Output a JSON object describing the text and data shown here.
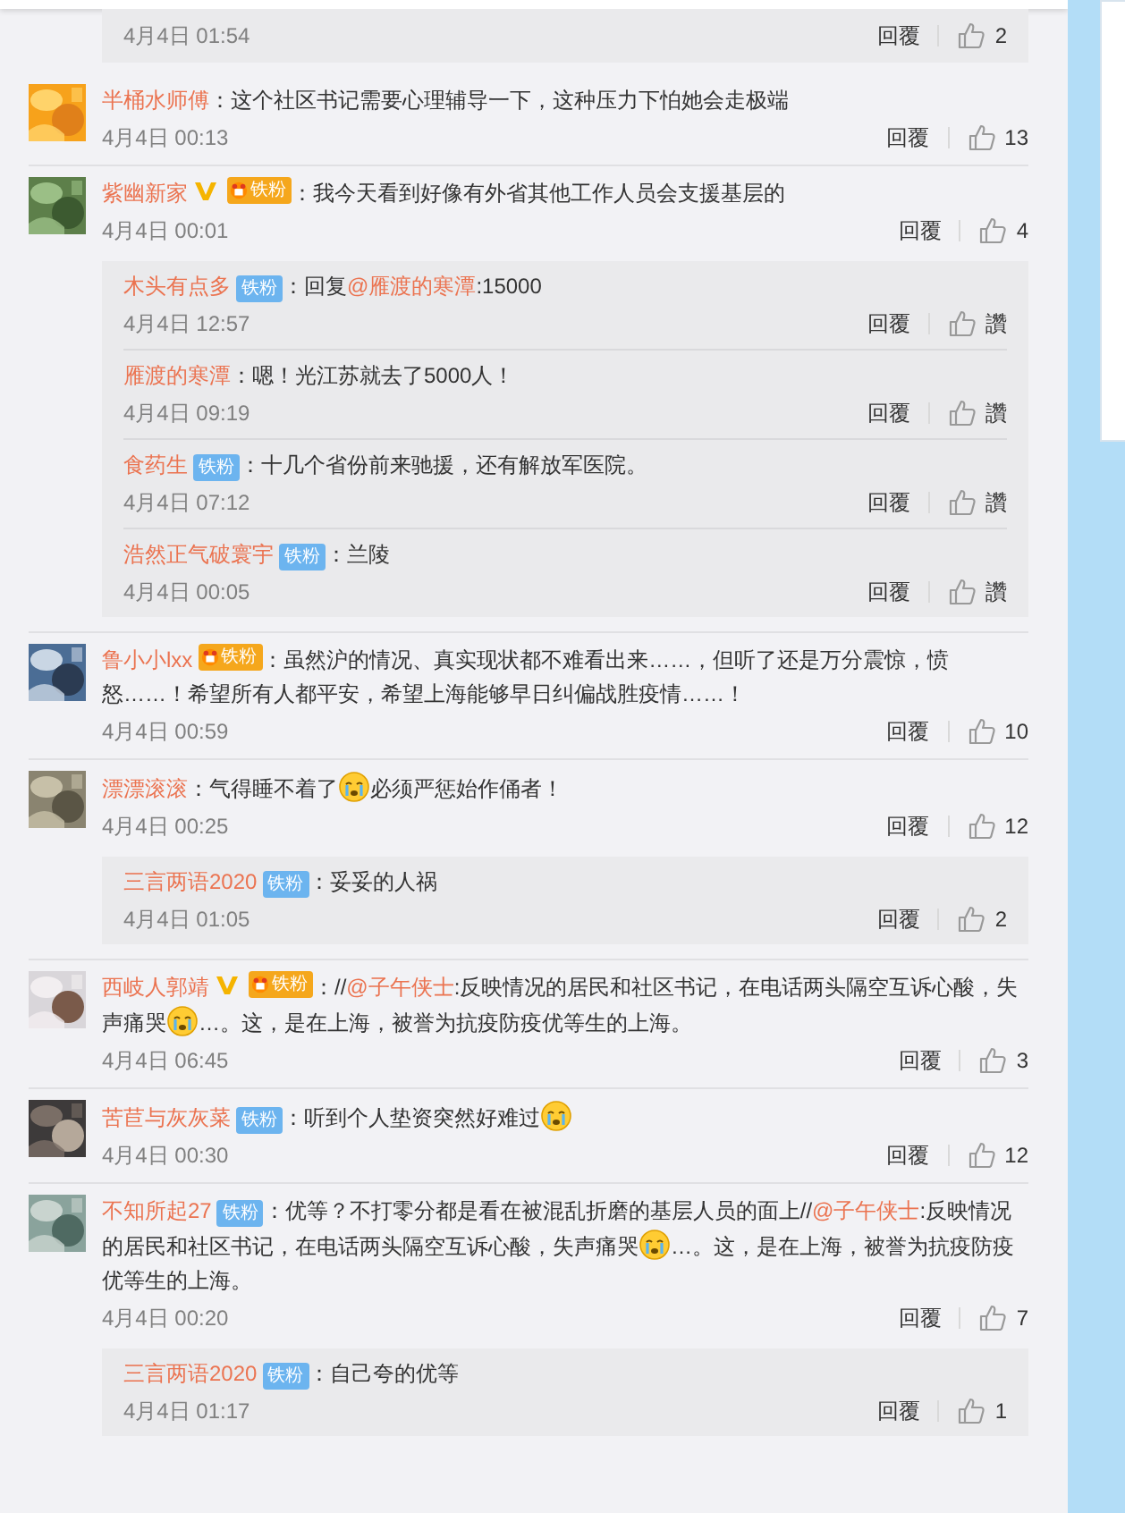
{
  "top_reply": {
    "time": "4月4日 01:54",
    "reply": "回覆",
    "likes": "2"
  },
  "comments": [
    {
      "user": "半桶水师傅",
      "verified": false,
      "segments": [
        {
          "kind": "text",
          "text": "：这个社区书记需要心理辅导一下，这种压力下怕她会走极端"
        }
      ],
      "time": "4月4日 00:13",
      "reply": "回覆",
      "likes": "13"
    },
    {
      "user": "紫幽新家",
      "verified": true,
      "badge": {
        "kind": "gold",
        "label": "铁粉"
      },
      "segments": [
        {
          "kind": "text",
          "text": "：我今天看到好像有外省其他工作人员会支援基层的"
        }
      ],
      "time": "4月4日 00:01",
      "reply": "回覆",
      "likes": "4",
      "replies": [
        {
          "user": "木头有点多",
          "badge": {
            "kind": "blue",
            "label": "铁粉"
          },
          "segments": [
            {
              "kind": "text",
              "text": "：回复"
            },
            {
              "kind": "link",
              "text": "@雁渡的寒潭"
            },
            {
              "kind": "text",
              "text": ":15000"
            }
          ],
          "time": "4月4日 12:57",
          "reply": "回覆",
          "likes": "讚"
        },
        {
          "user": "雁渡的寒潭",
          "segments": [
            {
              "kind": "text",
              "text": "：嗯！光江苏就去了5000人！"
            }
          ],
          "time": "4月4日 09:19",
          "reply": "回覆",
          "likes": "讚"
        },
        {
          "user": "食药生",
          "badge": {
            "kind": "blue",
            "label": "铁粉"
          },
          "segments": [
            {
              "kind": "text",
              "text": "：十几个省份前来驰援，还有解放军医院。"
            }
          ],
          "time": "4月4日 07:12",
          "reply": "回覆",
          "likes": "讚"
        },
        {
          "user": "浩然正气破寰宇",
          "badge": {
            "kind": "blue",
            "label": "铁粉"
          },
          "segments": [
            {
              "kind": "text",
              "text": "：兰陵"
            }
          ],
          "time": "4月4日 00:05",
          "reply": "回覆",
          "likes": "讚"
        }
      ]
    },
    {
      "user": "鲁小小lxx",
      "verified": false,
      "badge": {
        "kind": "gold",
        "label": "铁粉"
      },
      "segments": [
        {
          "kind": "text",
          "text": "：虽然沪的情况、真实现状都不难看出来……，但听了还是万分震惊，愤怒……！希望所有人都平安，希望上海能够早日纠偏战胜疫情……！"
        }
      ],
      "time": "4月4日 00:59",
      "reply": "回覆",
      "likes": "10"
    },
    {
      "user": "漂漂滚滚",
      "verified": false,
      "segments": [
        {
          "kind": "text",
          "text": "：气得睡不着了"
        },
        {
          "kind": "emoji"
        },
        {
          "kind": "text",
          "text": "必须严惩始作俑者！"
        }
      ],
      "time": "4月4日 00:25",
      "reply": "回覆",
      "likes": "12",
      "replies": [
        {
          "user": "三言两语2020",
          "badge": {
            "kind": "blue",
            "label": "铁粉"
          },
          "segments": [
            {
              "kind": "text",
              "text": "：妥妥的人祸"
            }
          ],
          "time": "4月4日 01:05",
          "reply": "回覆",
          "likes": "2"
        }
      ]
    },
    {
      "user": "西岐人郭靖",
      "verified": true,
      "badge": {
        "kind": "gold",
        "label": "铁粉"
      },
      "segments": [
        {
          "kind": "text",
          "text": "：//"
        },
        {
          "kind": "link",
          "text": "@子午侠士"
        },
        {
          "kind": "text",
          "text": ":反映情况的居民和社区书记，在电话两头隔空互诉心酸，失声痛哭"
        },
        {
          "kind": "emoji"
        },
        {
          "kind": "text",
          "text": "…。这，是在上海，被誉为抗疫防疫优等生的上海。"
        }
      ],
      "time": "4月4日 06:45",
      "reply": "回覆",
      "likes": "3"
    },
    {
      "user": "苦苣与灰灰菜",
      "verified": false,
      "badge": {
        "kind": "blue",
        "label": "铁粉"
      },
      "segments": [
        {
          "kind": "text",
          "text": "：听到个人垫资突然好难过"
        },
        {
          "kind": "emoji"
        }
      ],
      "time": "4月4日 00:30",
      "reply": "回覆",
      "likes": "12"
    },
    {
      "user": "不知所起27",
      "verified": false,
      "badge": {
        "kind": "blue",
        "label": "铁粉"
      },
      "segments": [
        {
          "kind": "text",
          "text": "：优等？不打零分都是看在被混乱折磨的基层人员的面上//"
        },
        {
          "kind": "link",
          "text": "@子午侠士"
        },
        {
          "kind": "text",
          "text": ":反映情况的居民和社区书记，在电话两头隔空互诉心酸，失声痛哭"
        },
        {
          "kind": "emoji"
        },
        {
          "kind": "text",
          "text": "…。这，是在上海，被誉为抗疫防疫优等生的上海。"
        }
      ],
      "time": "4月4日 00:20",
      "reply": "回覆",
      "likes": "7",
      "replies": [
        {
          "user": "三言两语2020",
          "badge": {
            "kind": "blue",
            "label": "铁粉"
          },
          "segments": [
            {
              "kind": "text",
              "text": "：自己夸的优等"
            }
          ],
          "time": "4月4日 01:17",
          "reply": "回覆",
          "likes": "1"
        }
      ]
    }
  ]
}
